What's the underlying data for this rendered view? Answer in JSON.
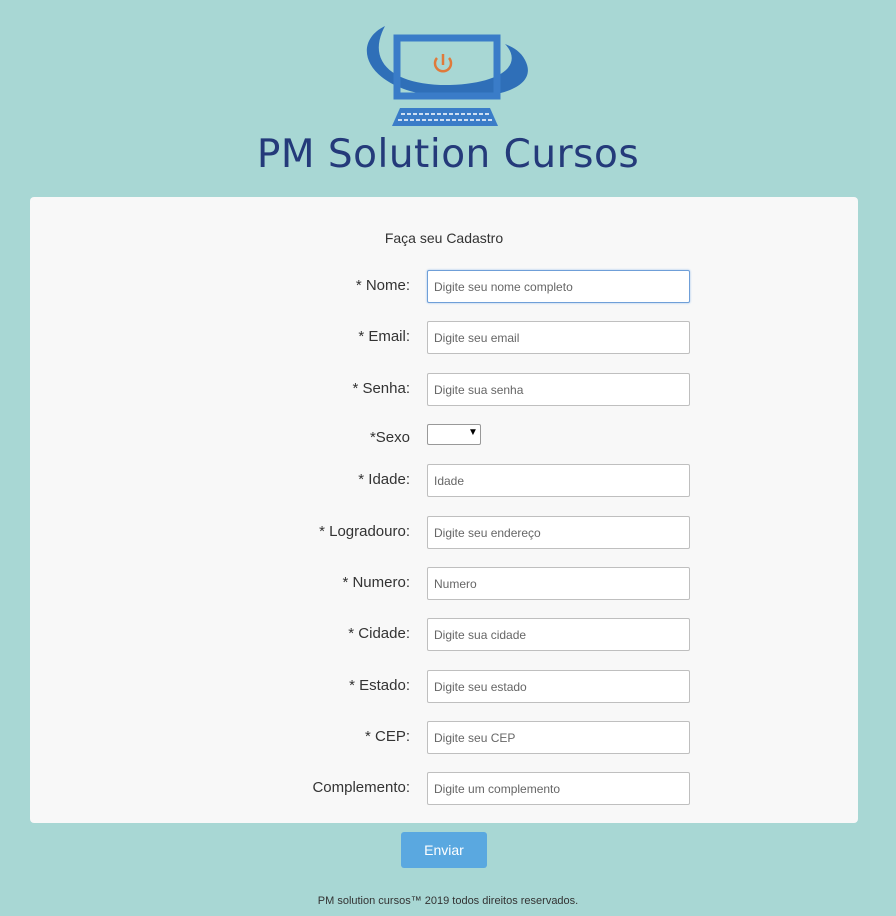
{
  "logo": {
    "text": "PM Solution Cursos"
  },
  "form": {
    "title": "Faça seu Cadastro",
    "fields": [
      {
        "label": "* Nome:",
        "placeholder": "Digite seu nome completo"
      },
      {
        "label": "* Email:",
        "placeholder": "Digite seu email"
      },
      {
        "label": "* Senha:",
        "placeholder": "Digite sua senha"
      },
      {
        "label": "*Sexo",
        "value": ""
      },
      {
        "label": "* Idade:",
        "placeholder": "Idade"
      },
      {
        "label": "* Logradouro:",
        "placeholder": "Digite seu endereço"
      },
      {
        "label": "* Numero:",
        "placeholder": "Numero"
      },
      {
        "label": "* Cidade:",
        "placeholder": "Digite sua cidade"
      },
      {
        "label": "* Estado:",
        "placeholder": "Digite seu estado"
      },
      {
        "label": "* CEP:",
        "placeholder": "Digite seu CEP"
      },
      {
        "label": "Complemento:",
        "placeholder": "Digite um complemento"
      }
    ]
  },
  "submit_label": "Enviar",
  "footer": "PM solution cursos™ 2019 todos direitos reservados.",
  "colors": {
    "background": "#a8d7d4",
    "brand": "#243a7a",
    "button": "#5aa8e0",
    "power": "#e07a3a"
  },
  "icons": {
    "logo": "computer-monitor-power-icon",
    "select_arrow": "caret-down-icon"
  }
}
